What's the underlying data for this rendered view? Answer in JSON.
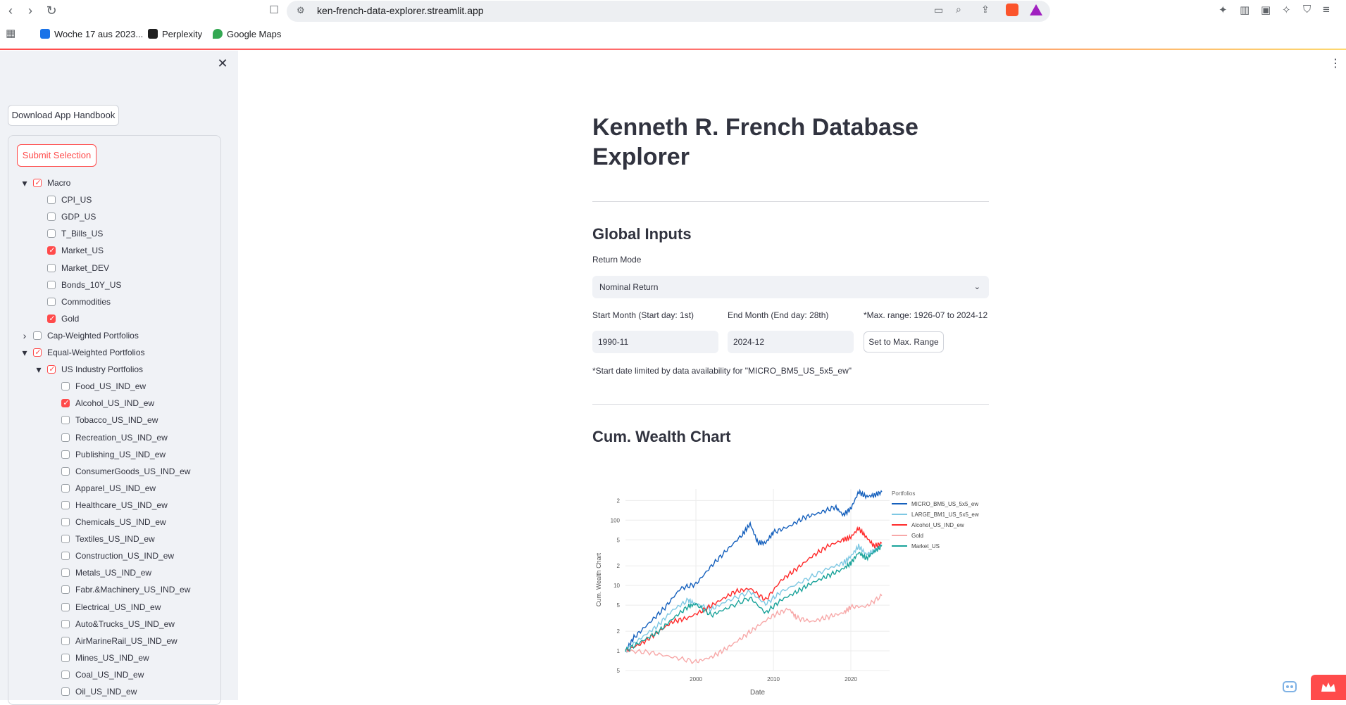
{
  "browser": {
    "url": "ken-french-data-explorer.streamlit.app",
    "bookmarks": [
      {
        "label": "Woche 17 aus 2023...",
        "icon": "calendar-icon"
      },
      {
        "label": "Perplexity",
        "icon": "perplexity-icon"
      },
      {
        "label": "Google Maps",
        "icon": "map-pin-icon"
      }
    ]
  },
  "sidebar": {
    "download_label": "Download App Handbook",
    "submit_label": "Submit Selection",
    "tree": [
      {
        "label": "Macro",
        "level": 0,
        "expand": "open",
        "state": "partial"
      },
      {
        "label": "CPI_US",
        "level": 1,
        "state": "none"
      },
      {
        "label": "GDP_US",
        "level": 1,
        "state": "none"
      },
      {
        "label": "T_Bills_US",
        "level": 1,
        "state": "none"
      },
      {
        "label": "Market_US",
        "level": 1,
        "state": "checked"
      },
      {
        "label": "Market_DEV",
        "level": 1,
        "state": "none"
      },
      {
        "label": "Bonds_10Y_US",
        "level": 1,
        "state": "none"
      },
      {
        "label": "Commodities",
        "level": 1,
        "state": "none"
      },
      {
        "label": "Gold",
        "level": 1,
        "state": "checked"
      },
      {
        "label": "Cap-Weighted Portfolios",
        "level": 0,
        "expand": "closed",
        "state": "none"
      },
      {
        "label": "Equal-Weighted Portfolios",
        "level": 0,
        "expand": "open",
        "state": "partial"
      },
      {
        "label": "US Industry Portfolios",
        "level": 1,
        "expand": "open",
        "state": "partial"
      },
      {
        "label": "Food_US_IND_ew",
        "level": 2,
        "state": "none"
      },
      {
        "label": "Alcohol_US_IND_ew",
        "level": 2,
        "state": "checked"
      },
      {
        "label": "Tobacco_US_IND_ew",
        "level": 2,
        "state": "none"
      },
      {
        "label": "Recreation_US_IND_ew",
        "level": 2,
        "state": "none"
      },
      {
        "label": "Publishing_US_IND_ew",
        "level": 2,
        "state": "none"
      },
      {
        "label": "ConsumerGoods_US_IND_ew",
        "level": 2,
        "state": "none"
      },
      {
        "label": "Apparel_US_IND_ew",
        "level": 2,
        "state": "none"
      },
      {
        "label": "Healthcare_US_IND_ew",
        "level": 2,
        "state": "none"
      },
      {
        "label": "Chemicals_US_IND_ew",
        "level": 2,
        "state": "none"
      },
      {
        "label": "Textiles_US_IND_ew",
        "level": 2,
        "state": "none"
      },
      {
        "label": "Construction_US_IND_ew",
        "level": 2,
        "state": "none"
      },
      {
        "label": "Metals_US_IND_ew",
        "level": 2,
        "state": "none"
      },
      {
        "label": "Fabr.&Machinery_US_IND_ew",
        "level": 2,
        "state": "none"
      },
      {
        "label": "Electrical_US_IND_ew",
        "level": 2,
        "state": "none"
      },
      {
        "label": "Auto&Trucks_US_IND_ew",
        "level": 2,
        "state": "none"
      },
      {
        "label": "AirMarineRail_US_IND_ew",
        "level": 2,
        "state": "none"
      },
      {
        "label": "Mines_US_IND_ew",
        "level": 2,
        "state": "none"
      },
      {
        "label": "Coal_US_IND_ew",
        "level": 2,
        "state": "none"
      },
      {
        "label": "Oil_US_IND_ew",
        "level": 2,
        "state": "none"
      }
    ]
  },
  "main": {
    "title": "Kenneth R. French Database Explorer",
    "global_inputs_heading": "Global Inputs",
    "return_mode_label": "Return Mode",
    "return_mode_value": "Nominal Return",
    "start_label": "Start Month (Start day: 1st)",
    "start_value": "1990-11",
    "end_label": "End Month (End day: 28th)",
    "end_value": "2024-12",
    "max_range_note": "*Max. range: 1926-07 to 2024-12",
    "max_range_button": "Set to Max. Range",
    "start_limit_note": "*Start date limited by data availability for \"MICRO_BM5_US_5x5_ew\"",
    "chart_heading": "Cum. Wealth Chart"
  },
  "chart_data": {
    "type": "line",
    "xlabel": "Date",
    "ylabel": "Cum. Wealth Chart",
    "y_scale": "log",
    "x_ticks": [
      "2000",
      "2010",
      "2020"
    ],
    "y_ticks": [
      "5",
      "1",
      "2",
      "5",
      "10",
      "2",
      "5",
      "100",
      "2"
    ],
    "legend_title": "Portfolios",
    "legend_position": "right",
    "x_range": [
      1990.9,
      2025.0
    ],
    "y_range": [
      0.5,
      300
    ],
    "series": [
      {
        "name": "MICRO_BM5_US_5x5_ew",
        "color": "#1560bd",
        "points": [
          [
            1990.9,
            1.0
          ],
          [
            1992,
            1.6
          ],
          [
            1994,
            2.7
          ],
          [
            1996,
            4.6
          ],
          [
            1998,
            9.0
          ],
          [
            2000,
            10.5
          ],
          [
            2002,
            20
          ],
          [
            2004,
            35
          ],
          [
            2006,
            60
          ],
          [
            2007,
            88
          ],
          [
            2008,
            45
          ],
          [
            2009,
            45
          ],
          [
            2010,
            65
          ],
          [
            2012,
            80
          ],
          [
            2014,
            110
          ],
          [
            2016,
            130
          ],
          [
            2018,
            160
          ],
          [
            2019,
            120
          ],
          [
            2020,
            150
          ],
          [
            2021,
            270
          ],
          [
            2022,
            230
          ],
          [
            2023,
            240
          ],
          [
            2024,
            270
          ]
        ]
      },
      {
        "name": "LARGE_BM1_US_5x5_ew",
        "color": "#7ec8e3",
        "points": [
          [
            1990.9,
            1.0
          ],
          [
            1993,
            1.6
          ],
          [
            1995,
            2.4
          ],
          [
            1997,
            4.2
          ],
          [
            1999,
            6.0
          ],
          [
            2000,
            5.2
          ],
          [
            2002,
            4.3
          ],
          [
            2004,
            5.8
          ],
          [
            2007,
            8.0
          ],
          [
            2009,
            5.2
          ],
          [
            2011,
            8.0
          ],
          [
            2014,
            12
          ],
          [
            2017,
            18
          ],
          [
            2019,
            22
          ],
          [
            2020,
            28
          ],
          [
            2021,
            40
          ],
          [
            2022,
            30
          ],
          [
            2023,
            34
          ],
          [
            2024,
            42
          ]
        ]
      },
      {
        "name": "Alcohol_US_IND_ew",
        "color": "#ff2b2b",
        "points": [
          [
            1990.9,
            1.0
          ],
          [
            1993,
            1.3
          ],
          [
            1995,
            1.9
          ],
          [
            1997,
            2.8
          ],
          [
            1999,
            3.2
          ],
          [
            2001,
            4.2
          ],
          [
            2003,
            5.8
          ],
          [
            2005,
            8.0
          ],
          [
            2007,
            9.0
          ],
          [
            2009,
            6.0
          ],
          [
            2011,
            12
          ],
          [
            2013,
            18
          ],
          [
            2015,
            28
          ],
          [
            2017,
            40
          ],
          [
            2019,
            50
          ],
          [
            2020,
            55
          ],
          [
            2021,
            75
          ],
          [
            2022,
            55
          ],
          [
            2023,
            40
          ],
          [
            2024,
            45
          ]
        ]
      },
      {
        "name": "Gold",
        "color": "#f7a8a8",
        "points": [
          [
            1990.9,
            1.0
          ],
          [
            1994,
            0.95
          ],
          [
            1997,
            0.8
          ],
          [
            2000,
            0.68
          ],
          [
            2002,
            0.8
          ],
          [
            2004,
            1.1
          ],
          [
            2006,
            1.6
          ],
          [
            2008,
            2.4
          ],
          [
            2010,
            3.5
          ],
          [
            2012,
            4.4
          ],
          [
            2013,
            3.2
          ],
          [
            2015,
            2.8
          ],
          [
            2017,
            3.3
          ],
          [
            2019,
            3.8
          ],
          [
            2020,
            4.7
          ],
          [
            2022,
            4.8
          ],
          [
            2024,
            7.0
          ]
        ]
      },
      {
        "name": "Market_US",
        "color": "#1aa39a",
        "points": [
          [
            1990.9,
            1.0
          ],
          [
            1993,
            1.4
          ],
          [
            1995,
            1.9
          ],
          [
            1997,
            3.1
          ],
          [
            1999,
            4.8
          ],
          [
            2000,
            5.2
          ],
          [
            2002,
            3.5
          ],
          [
            2004,
            4.5
          ],
          [
            2007,
            6.5
          ],
          [
            2009,
            3.8
          ],
          [
            2011,
            6.0
          ],
          [
            2013,
            8.0
          ],
          [
            2015,
            11
          ],
          [
            2017,
            14
          ],
          [
            2019,
            18
          ],
          [
            2020,
            22
          ],
          [
            2021,
            32
          ],
          [
            2022,
            26
          ],
          [
            2023,
            33
          ],
          [
            2024,
            40
          ]
        ]
      }
    ]
  }
}
